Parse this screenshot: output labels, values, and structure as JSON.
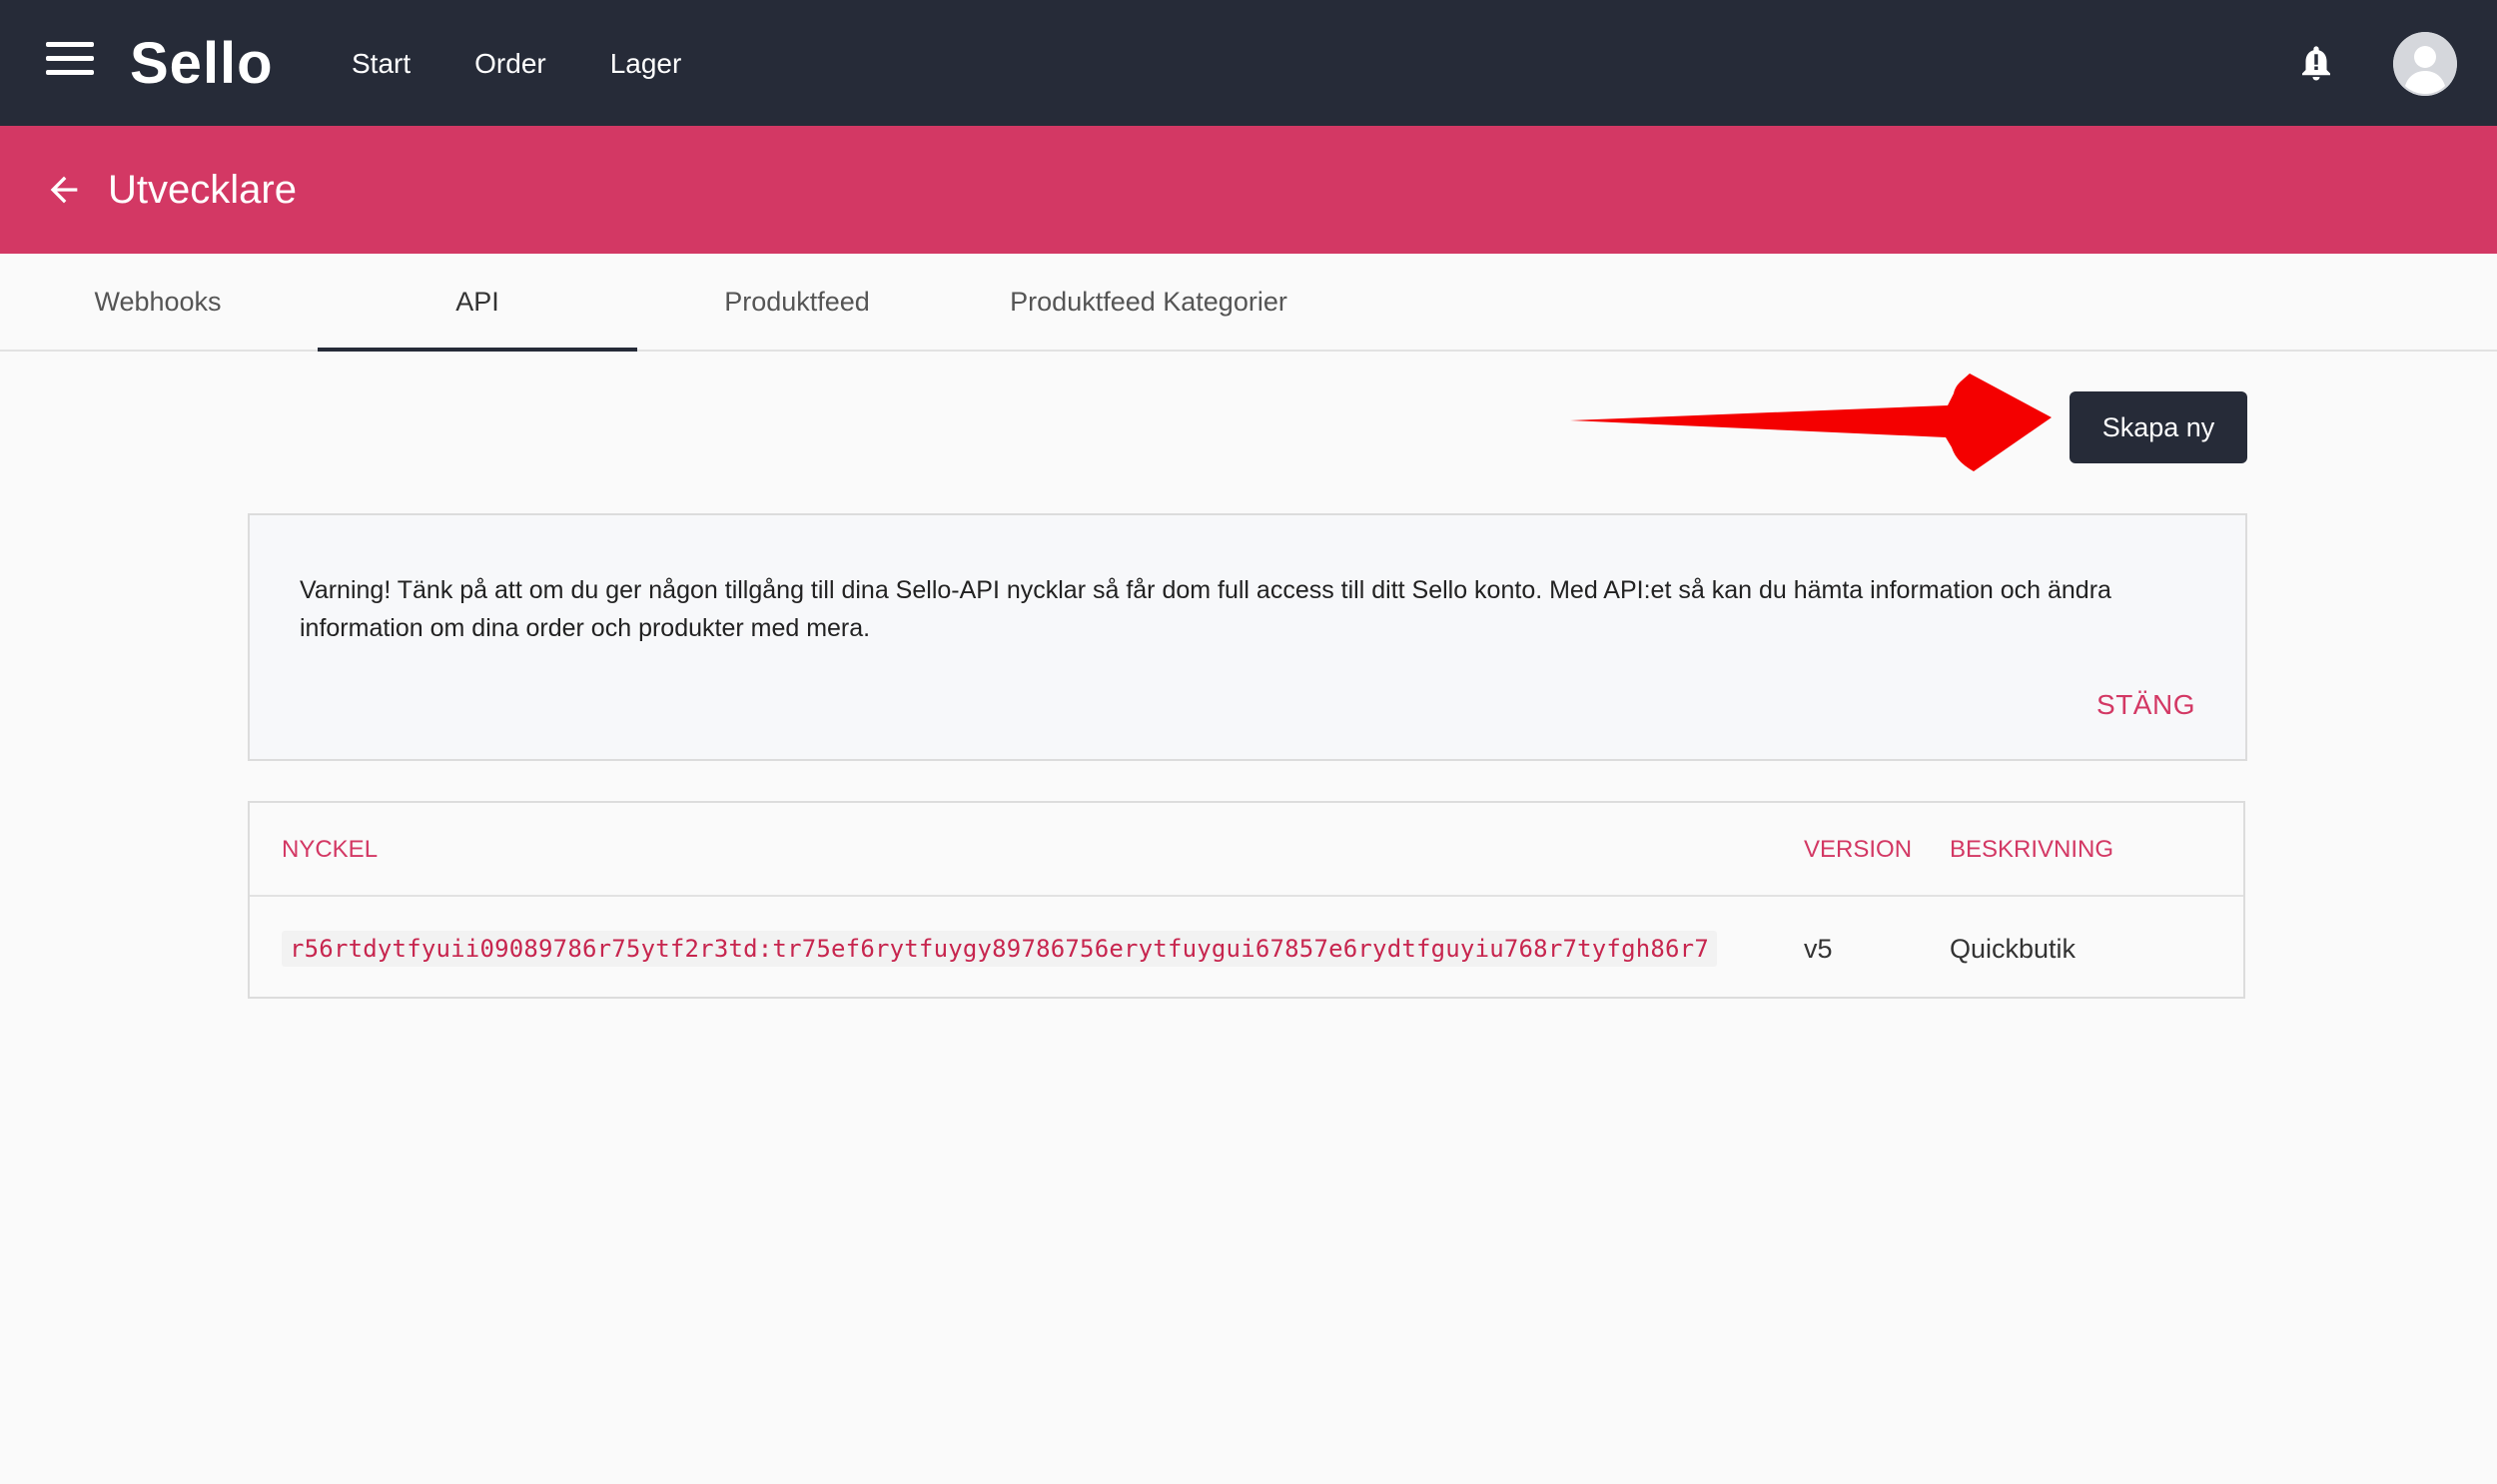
{
  "topbar": {
    "brand": "Sello",
    "nav": [
      {
        "label": "Start"
      },
      {
        "label": "Order"
      },
      {
        "label": "Lager"
      }
    ],
    "icons": {
      "menu": "menu-icon",
      "bell": "bell-icon",
      "avatar": "avatar-icon"
    }
  },
  "header": {
    "title": "Utvecklare",
    "color": "#d33864"
  },
  "tabs": [
    {
      "label": "Webhooks",
      "active": false
    },
    {
      "label": "API",
      "active": true
    },
    {
      "label": "Produktfeed",
      "active": false
    },
    {
      "label": "Produktfeed Kategorier",
      "active": false
    }
  ],
  "actions": {
    "create_label": "Skapa ny"
  },
  "warning": {
    "text": "Varning! Tänk på att om du ger någon tillgång till dina Sello-API nycklar så får dom full access till ditt Sello konto. Med API:et så kan du hämta information och ändra information om dina order och produkter med mera.",
    "close_label": "STÄNG"
  },
  "table": {
    "columns": [
      "NYCKEL",
      "VERSION",
      "BESKRIVNING"
    ],
    "rows": [
      {
        "key": "r56rtdytfyuii09089786r75ytf2r3td:tr75ef6rytfuygy89786756erytfuygui67857e6rydtfguyiu768r7tyfgh86r7",
        "version": "v5",
        "description": "Quickbutik"
      }
    ]
  },
  "colors": {
    "topbar": "#262b38",
    "accent": "#d33864",
    "arrow": "#f40000"
  }
}
